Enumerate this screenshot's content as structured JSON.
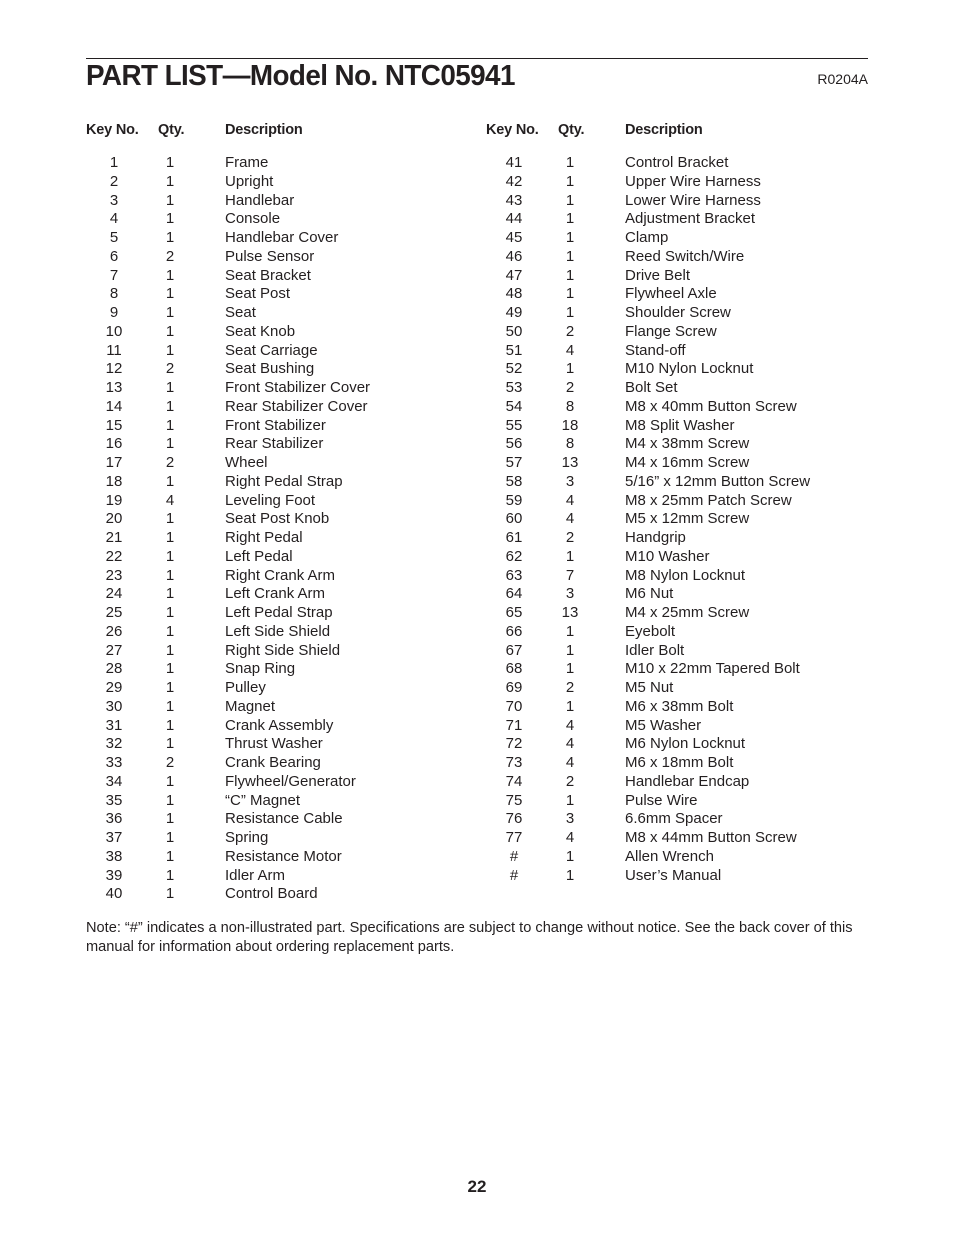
{
  "header": {
    "title": "PART LIST—Model No. NTC05941",
    "code": "R0204A"
  },
  "columns": {
    "key_no": "Key No.",
    "qty": "Qty.",
    "description": "Description"
  },
  "parts_left": [
    {
      "key": "1",
      "qty": "1",
      "desc": "Frame"
    },
    {
      "key": "2",
      "qty": "1",
      "desc": "Upright"
    },
    {
      "key": "3",
      "qty": "1",
      "desc": "Handlebar"
    },
    {
      "key": "4",
      "qty": "1",
      "desc": "Console"
    },
    {
      "key": "5",
      "qty": "1",
      "desc": "Handlebar Cover"
    },
    {
      "key": "6",
      "qty": "2",
      "desc": "Pulse Sensor"
    },
    {
      "key": "7",
      "qty": "1",
      "desc": "Seat Bracket"
    },
    {
      "key": "8",
      "qty": "1",
      "desc": "Seat Post"
    },
    {
      "key": "9",
      "qty": "1",
      "desc": "Seat"
    },
    {
      "key": "10",
      "qty": "1",
      "desc": "Seat Knob"
    },
    {
      "key": "11",
      "qty": "1",
      "desc": "Seat Carriage"
    },
    {
      "key": "12",
      "qty": "2",
      "desc": "Seat Bushing"
    },
    {
      "key": "13",
      "qty": "1",
      "desc": "Front Stabilizer Cover"
    },
    {
      "key": "14",
      "qty": "1",
      "desc": "Rear Stabilizer Cover"
    },
    {
      "key": "15",
      "qty": "1",
      "desc": "Front Stabilizer"
    },
    {
      "key": "16",
      "qty": "1",
      "desc": "Rear Stabilizer"
    },
    {
      "key": "17",
      "qty": "2",
      "desc": "Wheel"
    },
    {
      "key": "18",
      "qty": "1",
      "desc": "Right Pedal Strap"
    },
    {
      "key": "19",
      "qty": "4",
      "desc": "Leveling Foot"
    },
    {
      "key": "20",
      "qty": "1",
      "desc": "Seat Post Knob"
    },
    {
      "key": "21",
      "qty": "1",
      "desc": "Right Pedal"
    },
    {
      "key": "22",
      "qty": "1",
      "desc": "Left Pedal"
    },
    {
      "key": "23",
      "qty": "1",
      "desc": "Right Crank Arm"
    },
    {
      "key": "24",
      "qty": "1",
      "desc": "Left Crank Arm"
    },
    {
      "key": "25",
      "qty": "1",
      "desc": "Left Pedal Strap"
    },
    {
      "key": "26",
      "qty": "1",
      "desc": "Left Side Shield"
    },
    {
      "key": "27",
      "qty": "1",
      "desc": "Right Side Shield"
    },
    {
      "key": "28",
      "qty": "1",
      "desc": "Snap Ring"
    },
    {
      "key": "29",
      "qty": "1",
      "desc": "Pulley"
    },
    {
      "key": "30",
      "qty": "1",
      "desc": "Magnet"
    },
    {
      "key": "31",
      "qty": "1",
      "desc": "Crank Assembly"
    },
    {
      "key": "32",
      "qty": "1",
      "desc": "Thrust Washer"
    },
    {
      "key": "33",
      "qty": "2",
      "desc": "Crank Bearing"
    },
    {
      "key": "34",
      "qty": "1",
      "desc": "Flywheel/Generator"
    },
    {
      "key": "35",
      "qty": "1",
      "desc": "“C” Magnet"
    },
    {
      "key": "36",
      "qty": "1",
      "desc": "Resistance Cable"
    },
    {
      "key": "37",
      "qty": "1",
      "desc": "Spring"
    },
    {
      "key": "38",
      "qty": "1",
      "desc": "Resistance Motor"
    },
    {
      "key": "39",
      "qty": "1",
      "desc": "Idler Arm"
    },
    {
      "key": "40",
      "qty": "1",
      "desc": "Control Board"
    }
  ],
  "parts_right": [
    {
      "key": "41",
      "qty": "1",
      "desc": "Control Bracket"
    },
    {
      "key": "42",
      "qty": "1",
      "desc": "Upper Wire Harness"
    },
    {
      "key": "43",
      "qty": "1",
      "desc": "Lower Wire Harness"
    },
    {
      "key": "44",
      "qty": "1",
      "desc": "Adjustment Bracket"
    },
    {
      "key": "45",
      "qty": "1",
      "desc": "Clamp"
    },
    {
      "key": "46",
      "qty": "1",
      "desc": "Reed Switch/Wire"
    },
    {
      "key": "47",
      "qty": "1",
      "desc": "Drive Belt"
    },
    {
      "key": "48",
      "qty": "1",
      "desc": "Flywheel Axle"
    },
    {
      "key": "49",
      "qty": "1",
      "desc": "Shoulder Screw"
    },
    {
      "key": "50",
      "qty": "2",
      "desc": "Flange Screw"
    },
    {
      "key": "51",
      "qty": "4",
      "desc": "Stand-off"
    },
    {
      "key": "52",
      "qty": "1",
      "desc": "M10 Nylon Locknut"
    },
    {
      "key": "53",
      "qty": "2",
      "desc": "Bolt Set"
    },
    {
      "key": "54",
      "qty": "8",
      "desc": "M8 x 40mm Button Screw"
    },
    {
      "key": "55",
      "qty": "18",
      "desc": "M8 Split Washer"
    },
    {
      "key": "56",
      "qty": "8",
      "desc": "M4 x 38mm Screw"
    },
    {
      "key": "57",
      "qty": "13",
      "desc": "M4 x 16mm Screw"
    },
    {
      "key": "58",
      "qty": "3",
      "desc": "5/16” x 12mm Button Screw"
    },
    {
      "key": "59",
      "qty": "4",
      "desc": "M8 x 25mm Patch Screw"
    },
    {
      "key": "60",
      "qty": "4",
      "desc": "M5 x 12mm Screw"
    },
    {
      "key": "61",
      "qty": "2",
      "desc": "Handgrip"
    },
    {
      "key": "62",
      "qty": "1",
      "desc": "M10 Washer"
    },
    {
      "key": "63",
      "qty": "7",
      "desc": "M8 Nylon Locknut"
    },
    {
      "key": "64",
      "qty": "3",
      "desc": "M6 Nut"
    },
    {
      "key": "65",
      "qty": "13",
      "desc": "M4 x 25mm Screw"
    },
    {
      "key": "66",
      "qty": "1",
      "desc": "Eyebolt"
    },
    {
      "key": "67",
      "qty": "1",
      "desc": "Idler Bolt"
    },
    {
      "key": "68",
      "qty": "1",
      "desc": "M10 x 22mm Tapered Bolt"
    },
    {
      "key": "69",
      "qty": "2",
      "desc": "M5 Nut"
    },
    {
      "key": "70",
      "qty": "1",
      "desc": "M6 x 38mm Bolt"
    },
    {
      "key": "71",
      "qty": "4",
      "desc": "M5 Washer"
    },
    {
      "key": "72",
      "qty": "4",
      "desc": "M6 Nylon Locknut"
    },
    {
      "key": "73",
      "qty": "4",
      "desc": "M6 x 18mm Bolt"
    },
    {
      "key": "74",
      "qty": "2",
      "desc": "Handlebar Endcap"
    },
    {
      "key": "75",
      "qty": "1",
      "desc": "Pulse Wire"
    },
    {
      "key": "76",
      "qty": "3",
      "desc": "6.6mm Spacer"
    },
    {
      "key": "77",
      "qty": "4",
      "desc": "M8 x 44mm Button Screw"
    },
    {
      "key": "#",
      "qty": "1",
      "desc": "Allen Wrench"
    },
    {
      "key": "#",
      "qty": "1",
      "desc": "User’s Manual"
    }
  ],
  "note": "Note: “#” indicates a non-illustrated part. Specifications are subject to change without notice. See the back cover of this manual for information about ordering replacement parts.",
  "page_number": "22"
}
